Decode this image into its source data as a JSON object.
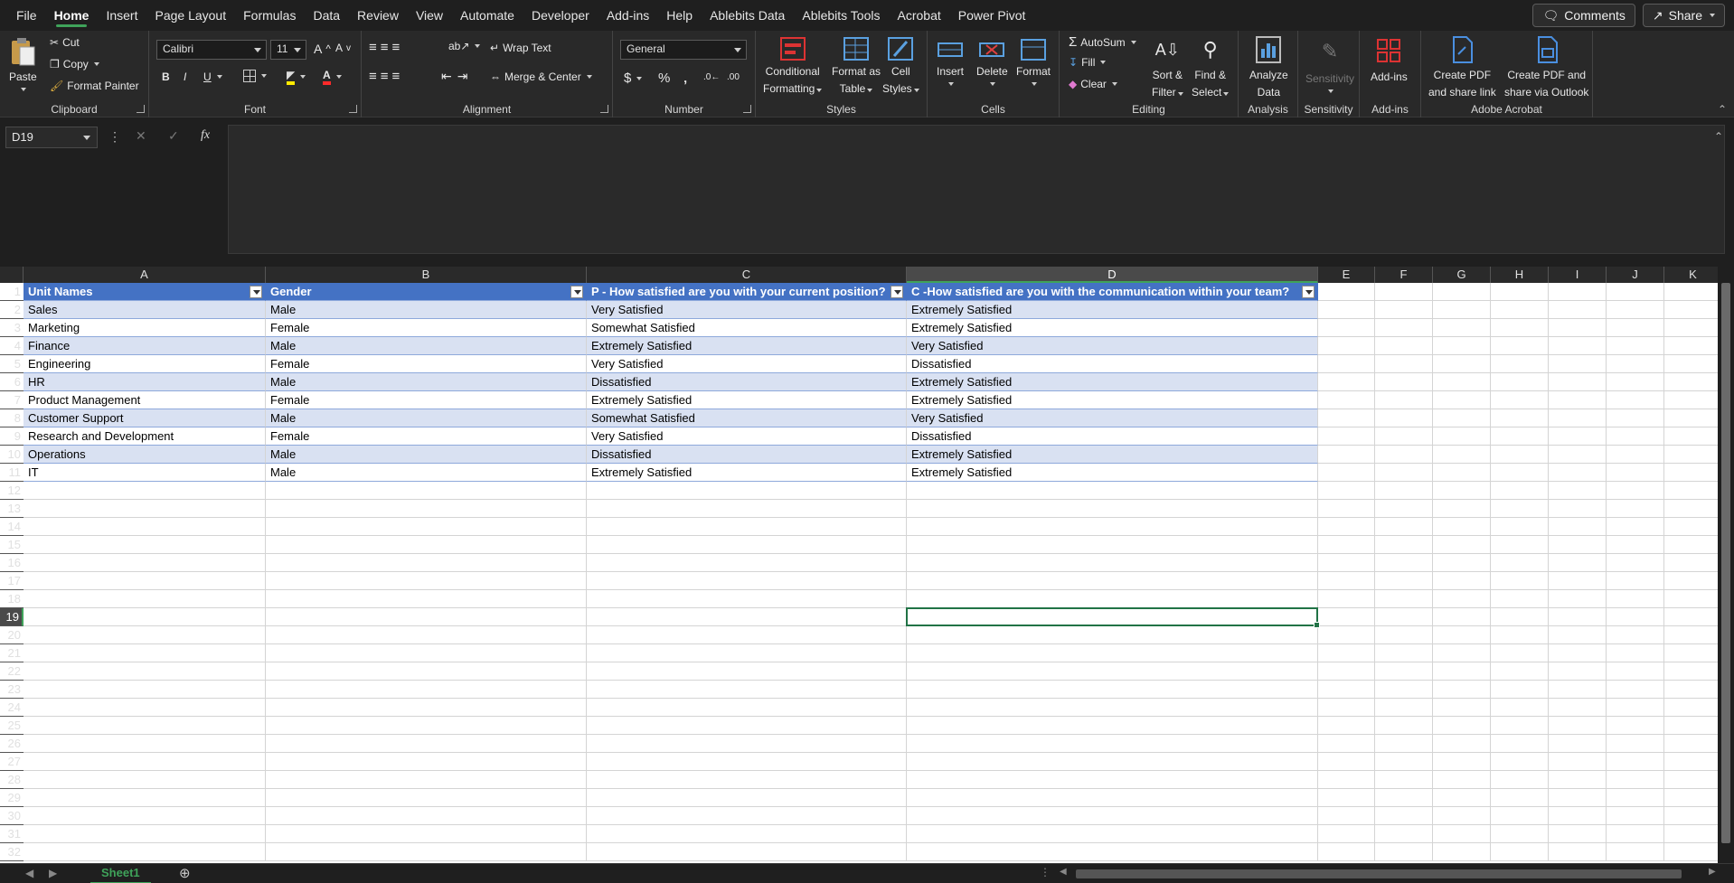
{
  "menu": {
    "tabs": [
      "File",
      "Home",
      "Insert",
      "Page Layout",
      "Formulas",
      "Data",
      "Review",
      "View",
      "Automate",
      "Developer",
      "Add-ins",
      "Help",
      "Ablebits Data",
      "Ablebits Tools",
      "Acrobat",
      "Power Pivot"
    ],
    "active": "Home",
    "comments_label": "Comments",
    "share_label": "Share"
  },
  "ribbon": {
    "clipboard": {
      "label": "Clipboard",
      "paste": "Paste",
      "cut": "Cut",
      "copy": "Copy",
      "format_painter": "Format Painter"
    },
    "font": {
      "label": "Font",
      "family": "Calibri",
      "size": "11"
    },
    "alignment": {
      "label": "Alignment",
      "wrap_text": "Wrap Text",
      "merge_center": "Merge & Center"
    },
    "number": {
      "label": "Number",
      "format": "General"
    },
    "styles": {
      "label": "Styles",
      "conditional": "Conditional",
      "conditional2": "Formatting",
      "format_as": "Format as",
      "format_as2": "Table",
      "cell": "Cell",
      "cell2": "Styles"
    },
    "cells": {
      "label": "Cells",
      "insert": "Insert",
      "delete": "Delete",
      "format": "Format"
    },
    "editing": {
      "label": "Editing",
      "autosum": "AutoSum",
      "fill": "Fill",
      "clear": "Clear",
      "sort": "Sort &",
      "sort2": "Filter",
      "find": "Find &",
      "find2": "Select"
    },
    "analysis": {
      "label": "Analysis",
      "analyze": "Analyze",
      "analyze2": "Data"
    },
    "sensitivity": {
      "label": "Sensitivity",
      "btn": "Sensitivity"
    },
    "addins": {
      "label": "Add-ins",
      "btn": "Add-ins"
    },
    "acrobat": {
      "label": "Adobe Acrobat",
      "pdf_link": "Create PDF",
      "pdf_link2": "and share link",
      "pdf_outlook": "Create PDF and",
      "pdf_outlook2": "share via Outlook"
    }
  },
  "formula_bar": {
    "name_box": "D19",
    "fx": "fx",
    "formula": ""
  },
  "columns": [
    "A",
    "B",
    "C",
    "D",
    "E",
    "F",
    "G",
    "H",
    "I",
    "J",
    "K"
  ],
  "selected_column": "D",
  "selected_row": 19,
  "table": {
    "headers": [
      "Unit Names",
      "Gender",
      "P - How satisfied are you with your current position?",
      "C -How satisfied are you with the communication within your team?"
    ],
    "rows": [
      [
        "Sales",
        "Male",
        "Very Satisfied",
        "Extremely Satisfied"
      ],
      [
        "Marketing",
        "Female",
        "Somewhat Satisfied",
        "Extremely Satisfied"
      ],
      [
        "Finance",
        "Male",
        "Extremely Satisfied",
        "Very Satisfied"
      ],
      [
        "Engineering",
        "Female",
        "Very Satisfied",
        "Dissatisfied"
      ],
      [
        "HR",
        "Male",
        "Dissatisfied",
        "Extremely Satisfied"
      ],
      [
        "Product Management",
        "Female",
        "Extremely Satisfied",
        "Extremely Satisfied"
      ],
      [
        "Customer Support",
        "Male",
        "Somewhat Satisfied",
        "Very Satisfied"
      ],
      [
        "Research and Development",
        "Female",
        "Very Satisfied",
        "Dissatisfied"
      ],
      [
        "Operations",
        "Male",
        "Dissatisfied",
        "Extremely Satisfied"
      ],
      [
        "IT",
        "Male",
        "Extremely Satisfied",
        "Extremely Satisfied"
      ]
    ]
  },
  "row_count": 32,
  "sheet": {
    "name": "Sheet1"
  },
  "colors": {
    "accent": "#3fa35a",
    "table_header": "#4472c4",
    "band": "#d9e1f2",
    "selection": "#217346"
  }
}
